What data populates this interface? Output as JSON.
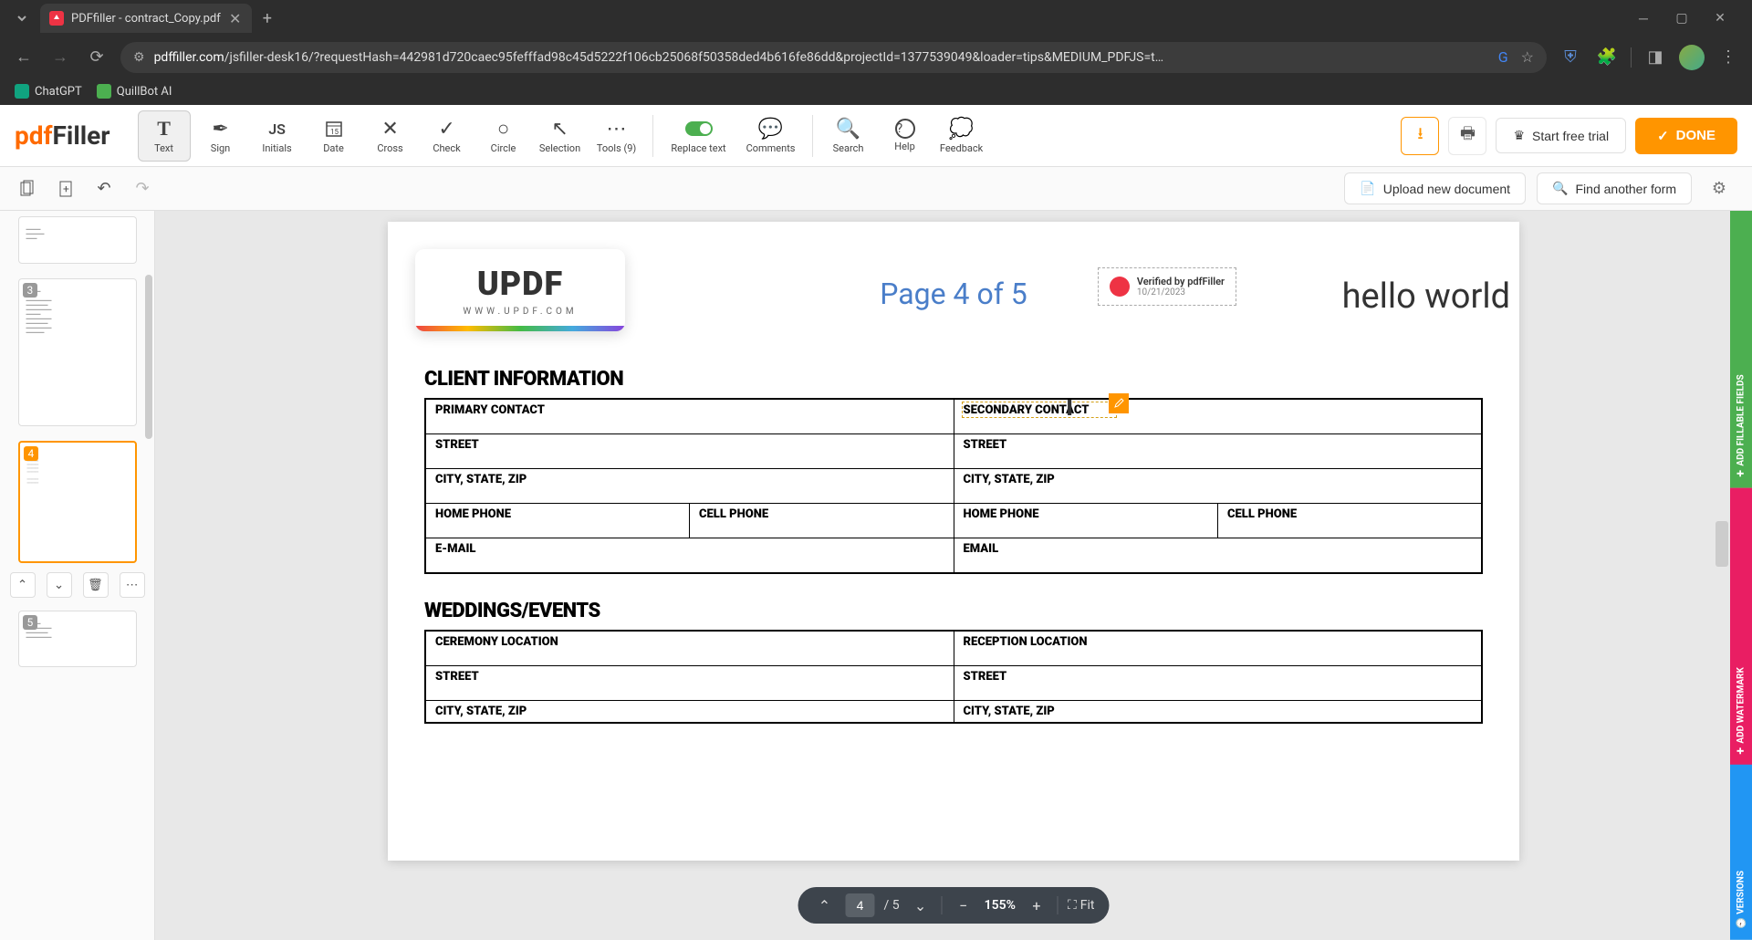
{
  "browser": {
    "tab_title": "PDFfiller - contract_Copy.pdf",
    "url_domain": "pdffiller.com",
    "url_path": "/jsfiller-desk16/?requestHash=442981d720caec95fefffad98c45d5222f106cb25068f50358ded4b616fe86dd&projectId=1377539049&loader=tips&MEDIUM_PDFJS=t…",
    "bookmarks": [
      {
        "label": "ChatGPT"
      },
      {
        "label": "QuillBot AI"
      }
    ]
  },
  "app": {
    "logo_prefix": "pdf",
    "logo_suffix": "Filler",
    "tools": [
      {
        "label": "Text",
        "icon": "T",
        "active": true
      },
      {
        "label": "Sign",
        "icon": "✒"
      },
      {
        "label": "Initials",
        "icon": "JS"
      },
      {
        "label": "Date",
        "icon": "📅"
      },
      {
        "label": "Cross",
        "icon": "✕"
      },
      {
        "label": "Check",
        "icon": "✓"
      },
      {
        "label": "Circle",
        "icon": "○"
      },
      {
        "label": "Selection",
        "icon": "↖"
      },
      {
        "label": "Tools (9)",
        "icon": "⋯"
      }
    ],
    "align_tools": [
      {
        "label": "Replace text",
        "toggle": true
      },
      {
        "label": "Comments"
      }
    ],
    "right_tools": [
      {
        "label": "Search",
        "icon": "🔍"
      },
      {
        "label": "Help",
        "icon": "?"
      },
      {
        "label": "Feedback",
        "icon": "💬"
      }
    ],
    "start_trial": "Start free trial",
    "done": "DONE",
    "subbar": {
      "upload": "Upload new document",
      "find": "Find another form"
    }
  },
  "thumbs": {
    "pages": [
      {
        "num": "",
        "visible_partial": true
      },
      {
        "num": "3"
      },
      {
        "num": "4",
        "active": true
      },
      {
        "num": "5"
      }
    ]
  },
  "page_content": {
    "updf_logo": "UPDF",
    "updf_url": "WWW.UPDF.COM",
    "page_indicator": "Page 4 of 5",
    "verified_text": "Verified by pdfFiller",
    "verified_date": "10/21/2023",
    "hello": "hello world",
    "section1_title": "CLIENT INFORMATION",
    "section2_title": "WEDDINGS/EVENTS",
    "table1": {
      "r1c1": "PRIMARY CONTACT",
      "r1c2": "SECONDARY CONTACT",
      "r2c1": "STREET",
      "r2c2": "STREET",
      "r3c1": "CITY, STATE, ZIP",
      "r3c2": "CITY, STATE, ZIP",
      "r4c1": "HOME PHONE",
      "r4c2": "CELL PHONE",
      "r4c3": "HOME PHONE",
      "r4c4": "CELL PHONE",
      "r5c1": "E-MAIL",
      "r5c2": "EMAIL"
    },
    "table2": {
      "r1c1": "CEREMONY LOCATION",
      "r1c2": "RECEPTION LOCATION",
      "r2c1": "STREET",
      "r2c2": "STREET",
      "r3c1": "CITY, STATE, ZIP",
      "r3c2": "CITY, STATE, ZIP"
    }
  },
  "page_nav": {
    "current": "4",
    "total": "/ 5",
    "zoom": "155%",
    "fit": "Fit"
  },
  "rail": {
    "fields": "ADD FILLABLE FIELDS",
    "watermark": "ADD WATERMARK",
    "versions": "VERSIONS"
  }
}
